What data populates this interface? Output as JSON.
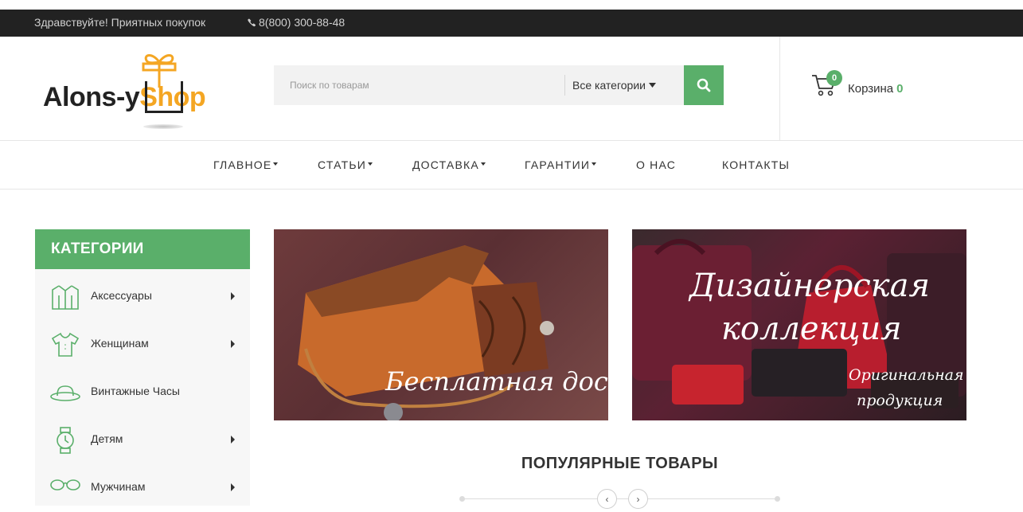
{
  "topbar": {
    "greeting": "Здравствуйте! Приятных покупок",
    "phone": "8(800) 300-88-48"
  },
  "logo": {
    "part1": "Alons-y",
    "part2": "Shop"
  },
  "search": {
    "placeholder": "Поиск по товарам",
    "category_label": "Все категории"
  },
  "cart": {
    "badge": "0",
    "label": "Корзина",
    "count": "0"
  },
  "nav": [
    {
      "label": "ГЛАВНОЕ"
    },
    {
      "label": "СТАТЬИ"
    },
    {
      "label": "ДОСТАВКА"
    },
    {
      "label": "ГАРАНТИИ"
    },
    {
      "label": "О НАС"
    },
    {
      "label": "КОНТАКТЫ"
    }
  ],
  "sidebar": {
    "title": "КАТЕГОРИИ",
    "items": [
      {
        "label": "Аксессуары",
        "icon": "jacket-icon"
      },
      {
        "label": "Женщинам",
        "icon": "shirt-icon"
      },
      {
        "label": "Винтажные Часы",
        "icon": "hat-icon"
      },
      {
        "label": "Детям",
        "icon": "watch-icon"
      },
      {
        "label": "Мужчинам",
        "icon": "glasses-icon"
      }
    ]
  },
  "banners": {
    "banner1_text": "Бесплатная доставка",
    "banner2_line1": "Дизайнерская",
    "banner2_line2": "коллекция",
    "banner2_sub1": "Оригинальная",
    "banner2_sub2": "продукция"
  },
  "popular": {
    "title": "ПОПУЛЯРНЫЕ ТОВАРЫ",
    "prev": "‹",
    "next": "›"
  },
  "colors": {
    "accent": "#5aaf6a",
    "topbar": "#222222",
    "logo_orange": "#f4a623"
  }
}
